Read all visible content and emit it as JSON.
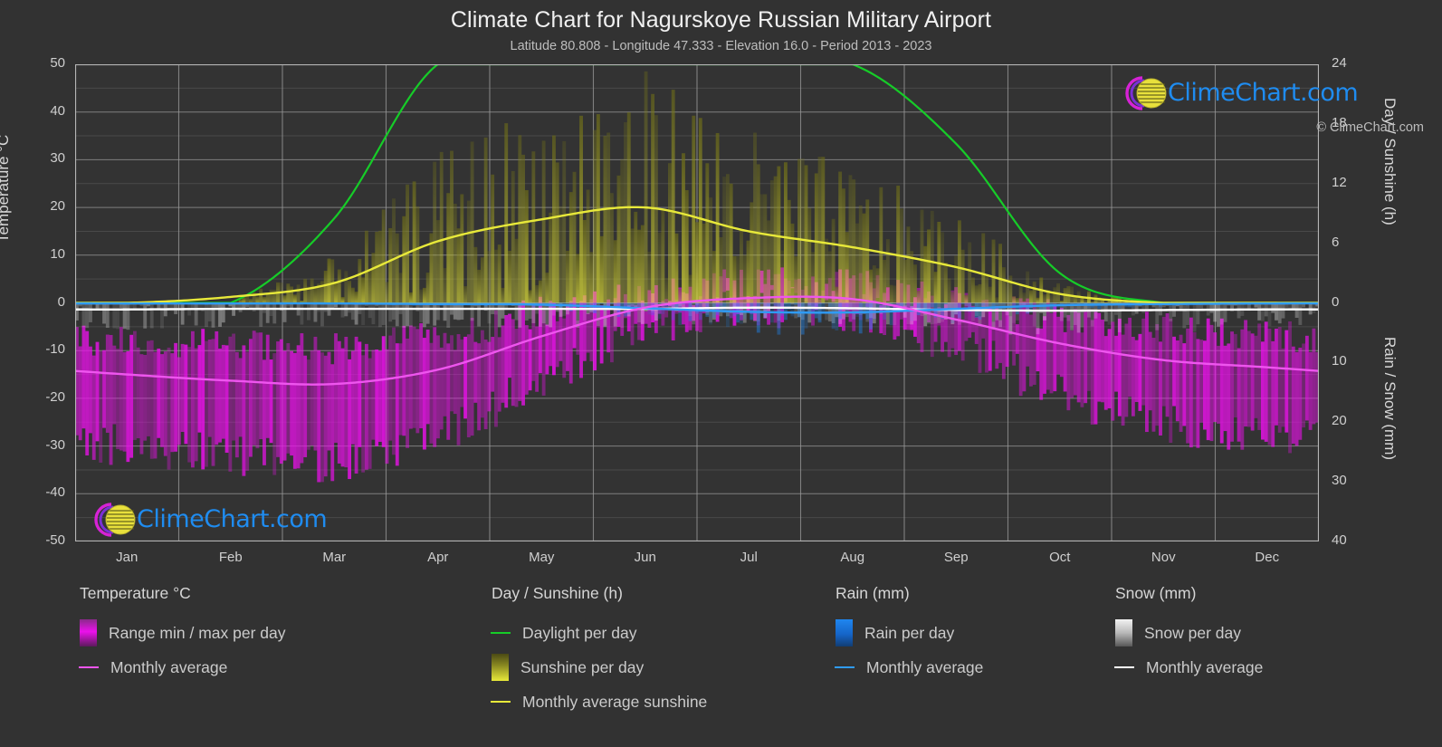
{
  "header": {
    "title": "Climate Chart for Nagurskoye Russian Military Airport",
    "subtitle": "Latitude 80.808 - Longitude 47.333 - Elevation 16.0 - Period 2013 - 2023"
  },
  "brand": {
    "name": "ClimeChart.com",
    "copyright": "© ClimeChart.com",
    "logo_arc_color": "#d622d6",
    "logo_sphere_color": "#e8e03c",
    "logo_text_color": "#1f8cf0"
  },
  "axes": {
    "left_title": "Temperature °C",
    "left_ticks": [
      "50",
      "40",
      "30",
      "20",
      "10",
      "0",
      "-10",
      "-20",
      "-30",
      "-40",
      "-50"
    ],
    "left_values": [
      50,
      40,
      30,
      20,
      10,
      0,
      -10,
      -20,
      -30,
      -40,
      -50
    ],
    "right_top_title": "Day / Sunshine (h)",
    "right_top_ticks": [
      "24",
      "18",
      "12",
      "6",
      "0"
    ],
    "right_top_values": [
      24,
      18,
      12,
      6,
      0
    ],
    "right_bottom_title": "Rain / Snow (mm)",
    "right_bottom_ticks": [
      "0",
      "10",
      "20",
      "30",
      "40"
    ],
    "right_bottom_values": [
      0,
      10,
      20,
      30,
      40
    ],
    "x_ticks": [
      "Jan",
      "Feb",
      "Mar",
      "Apr",
      "May",
      "Jun",
      "Jul",
      "Aug",
      "Sep",
      "Oct",
      "Nov",
      "Dec"
    ]
  },
  "legend": {
    "columns": [
      {
        "heading": "Temperature °C",
        "items": [
          {
            "type": "box",
            "label": "Range min / max per day",
            "color": "#ec11ec"
          },
          {
            "type": "line",
            "label": "Monthly average",
            "color": "#ee55ee"
          }
        ]
      },
      {
        "heading": "Day / Sunshine (h)",
        "items": [
          {
            "type": "line",
            "label": "Daylight per day",
            "color": "#16cc28"
          },
          {
            "type": "box",
            "label": "Sunshine per day",
            "color": "#e8e93a"
          },
          {
            "type": "line",
            "label": "Monthly average sunshine",
            "color": "#e8e93a"
          }
        ]
      },
      {
        "heading": "Rain (mm)",
        "items": [
          {
            "type": "box",
            "label": "Rain per day",
            "color": "#1675e8"
          },
          {
            "type": "line",
            "label": "Monthly average",
            "color": "#2f9bf5"
          }
        ]
      },
      {
        "heading": "Snow (mm)",
        "items": [
          {
            "type": "box",
            "label": "Snow per day",
            "color": "#e8e8e8"
          },
          {
            "type": "line",
            "label": "Monthly average",
            "color": "#ffffff"
          }
        ]
      }
    ]
  },
  "chart_data": {
    "type": "line",
    "title": "Climate Chart for Nagurskoye Russian Military Airport",
    "subtitle": "Latitude 80.808 - Longitude 47.333 - Elevation 16.0 - Period 2013 - 2023",
    "xlabel": "",
    "ylabel": "Temperature °C",
    "ylim": [
      -50,
      50
    ],
    "y2_top_label": "Day / Sunshine (h)",
    "y2_top_lim": [
      0,
      24
    ],
    "y2_bottom_label": "Rain / Snow (mm)",
    "y2_bottom_lim": [
      0,
      40
    ],
    "grid": true,
    "legend_position": "below",
    "categories": [
      "Jan",
      "Feb",
      "Mar",
      "Apr",
      "May",
      "Jun",
      "Jul",
      "Aug",
      "Sep",
      "Oct",
      "Nov",
      "Dec"
    ],
    "series": [
      {
        "name": "Monthly average temperature (°C)",
        "color": "#ee55ee",
        "axis": "left",
        "values": [
          -15.0,
          -16.3,
          -17.0,
          -14.0,
          -7.0,
          -1.0,
          1.0,
          0.8,
          -3.5,
          -8.5,
          -12.0,
          -13.5
        ]
      },
      {
        "name": "Daily max temperature envelope (°C)",
        "color": "#ec11ec",
        "axis": "left",
        "values": [
          -8.0,
          -9.0,
          -9.5,
          -7.0,
          -2.0,
          1.5,
          4.0,
          3.5,
          0.0,
          -3.0,
          -5.5,
          -7.0
        ]
      },
      {
        "name": "Daily min temperature envelope (°C)",
        "color": "#ec11ec",
        "axis": "left",
        "values": [
          -30.0,
          -32.0,
          -33.0,
          -28.0,
          -16.0,
          -5.0,
          -1.5,
          -2.0,
          -9.0,
          -19.0,
          -25.0,
          -28.0
        ]
      },
      {
        "name": "Daylight per day (h)",
        "color": "#16cc28",
        "axis": "right-top",
        "values": [
          0.0,
          0.0,
          8.5,
          24.0,
          24.0,
          24.0,
          24.0,
          24.0,
          16.0,
          3.0,
          0.0,
          0.0
        ]
      },
      {
        "name": "Monthly average sunshine (h)",
        "color": "#e8e93a",
        "axis": "right-top",
        "values": [
          0.0,
          0.6,
          2.0,
          6.2,
          8.4,
          9.6,
          7.2,
          5.6,
          3.6,
          0.9,
          0.0,
          0.0
        ]
      },
      {
        "name": "Monthly average rain (mm)",
        "color": "#2f9bf5",
        "axis": "right-bottom",
        "values": [
          0.1,
          0.1,
          0.1,
          0.2,
          0.3,
          0.9,
          1.5,
          1.6,
          1.0,
          0.4,
          0.2,
          0.1
        ]
      },
      {
        "name": "Monthly average snow (mm)",
        "color": "#ffffff",
        "axis": "right-bottom",
        "values": [
          1.1,
          1.0,
          1.0,
          1.0,
          1.0,
          1.0,
          0.8,
          0.9,
          1.2,
          1.3,
          1.2,
          1.1
        ]
      }
    ],
    "annotations": [
      {
        "text": "ClimeChart.com",
        "position": "top-right"
      },
      {
        "text": "ClimeChart.com",
        "position": "bottom-left"
      }
    ]
  }
}
